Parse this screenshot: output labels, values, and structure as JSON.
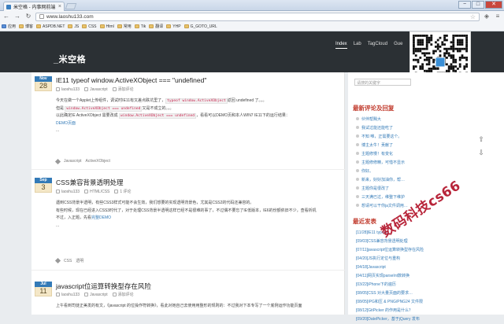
{
  "browser": {
    "tab_title": "米空格 - 内事网前端...",
    "tab_close": "×",
    "url": "www.laoshu133.com",
    "controls": {
      "minimize": "−",
      "maximize": "□",
      "close": "✕"
    },
    "bookmarks": [
      {
        "label": "应用",
        "kind": "app"
      },
      {
        "label": "博客",
        "kind": "folder"
      },
      {
        "label": "ASPDB.NET",
        "kind": "folder"
      },
      {
        "label": "JS",
        "kind": "folder"
      },
      {
        "label": "CSS",
        "kind": "folder"
      },
      {
        "label": "Html",
        "kind": "folder"
      },
      {
        "label": "常用",
        "kind": "folder"
      },
      {
        "label": "Tik",
        "kind": "folder"
      },
      {
        "label": "翻译",
        "kind": "folder"
      },
      {
        "label": "YHP",
        "kind": "folder"
      },
      {
        "label": "G_GOTO_URL",
        "kind": "folder"
      }
    ]
  },
  "site": {
    "logo": "_米空格",
    "nav": [
      {
        "label": "Index",
        "active": true
      },
      {
        "label": "Lab",
        "active": false
      },
      {
        "label": "TagCloud",
        "active": false
      },
      {
        "label": "Gue",
        "active": false
      }
    ]
  },
  "posts": [
    {
      "month": "Nov",
      "day": "28",
      "title": "IE11 typeof window.ActiveXObject === \"undefined\"",
      "author": "laoshu133",
      "category": "Javascript",
      "comments": "添加评论",
      "body": [
        {
          "text": "今天在做一个Applet上传组件，调试时IE11有又差点跌坑里了，",
          "code": "typeof window.ActiveXObject",
          "after": "返回 undefined 了。。。"
        },
        {
          "text": "但是 ",
          "code": "window.ActiveXObject === undefined",
          "after": "又是不成立的。。。"
        },
        {
          "text": "以此确定IE ActiveXObject 需要改成 ",
          "code": "window.ActiveXObject === undefined",
          "after": "，看看可以DEMO页和本人WIN7 IE11下的运行结果："
        }
      ],
      "link": "DEMO页面",
      "more": "...",
      "tags": [
        "Javascript",
        "ActiveXObject"
      ]
    },
    {
      "month": "Sep",
      "day": "3",
      "title": "CSS兼容背景透明处理",
      "author": "laoshu133",
      "category": "HTML/CSS",
      "comments": "1 评论",
      "body": [
        {
          "text": "遇到CSS背景半透明，有些CSS3样式可能不会生效，我们想要的实现透明背景色，尤其是CSS2的代码还兼容的。"
        },
        {
          "text": "有些时候，现在已经进入CSS3时代了，对于处理CSS背景半透明这样已经不是很难的事了，不过偶不要忘了IE低版本，IE6的份额依旧不少，查看析机"
        },
        {
          "text": "不过，入正题，先看",
          "link": "完整DEMO"
        }
      ],
      "more": "...",
      "tags": [
        "CSS",
        "透明"
      ]
    },
    {
      "month": "Jul",
      "day": "11",
      "title": "javascript位运算转换型存在风险",
      "author": "laoshu133",
      "category": "Javascript",
      "comments": "添加评论",
      "body": [
        {
          "text": "上午看到司徒正美发的有文，《javascript 的位操作符转换",
          "after": "》，看此对她自己去使用用整形的规则的：不过我对下本专写了一个底例运作功能页面"
        }
      ],
      "tags": []
    }
  ],
  "sidebar": {
    "search_placeholder": "请搜的关键字",
    "comments_title": "最新评论及回复",
    "comments": [
      "伙伴帮赐大",
      "我试过能还能吃了",
      "不知 唯，正需要这个。",
      "博主太牛！贡献了",
      "主题修慢！有变化",
      "主题修修精，可惜不显示",
      "你好。",
      "新来，好好加油你，帮…",
      "主题你是很改了",
      "三天满已过，维整下维护",
      "想请可以干你ja文件调用…"
    ],
    "recent_title": "最近发表",
    "recent": [
      "[11/28]IE11 typeof",
      "[09/03]CSS兼容背景透明处理",
      "[07/11]javascript位运算转换型存在风险",
      "[04/20]JS执行定位与重构",
      "[04/18]Javascript",
      "[04/11]网页实现parseInt数转换",
      "[03/22]iPhone下的遍历",
      "[08/05]CSS 对大量页面的要求…",
      "[08/05]IPG和压 & PNG/PNG24 文件限",
      "[08/12]GitPicker 的作用是什么？",
      "[09/20]DatePicker，基于jQuery 发布"
    ]
  },
  "watermark": "数码科技cs66",
  "qr_caption": ""
}
